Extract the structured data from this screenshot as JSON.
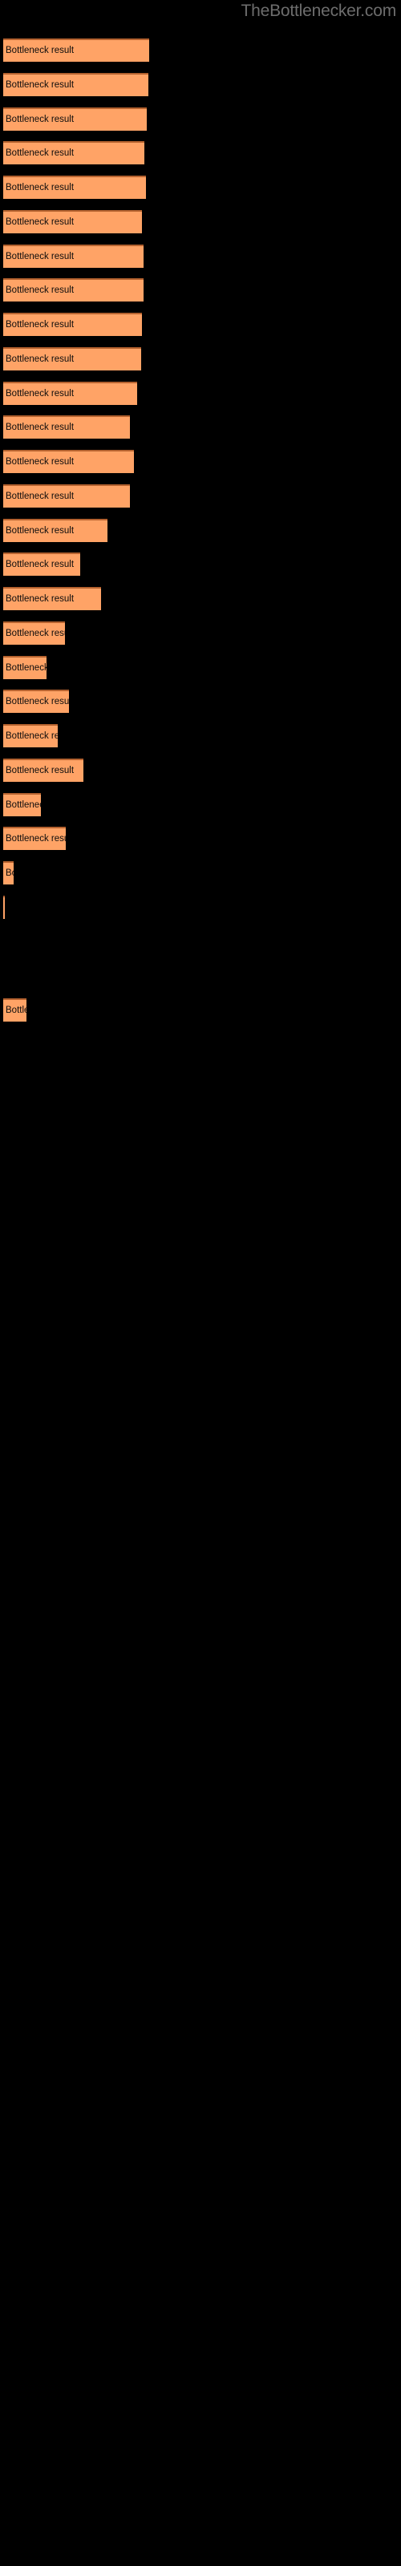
{
  "site": {
    "title": "TheBottlenecker.com",
    "title_color": "#6d6d6d"
  },
  "style": {
    "background": "#000000",
    "bar_fill": "#ffa366",
    "bar_top_border": "#b5622f",
    "label_color": "#0d0d0d"
  },
  "chart_data": {
    "type": "bar",
    "orientation": "horizontal",
    "title": "TheBottlenecker.com",
    "xlabel": "",
    "ylabel": "",
    "grid": false,
    "legend": null,
    "bar_label_text": "Bottleneck result",
    "xlim": [
      0,
      186
    ],
    "note": "Horizontal bar chart on black background; every bar is annotated with the text 'Bottleneck result' which is clipped to the bar width.",
    "categories": [
      "Bottleneck result",
      "Bottleneck result",
      "Bottleneck result",
      "Bottleneck result",
      "Bottleneck result",
      "Bottleneck result",
      "Bottleneck result",
      "Bottleneck result",
      "Bottleneck result",
      "Bottleneck result",
      "Bottleneck result",
      "Bottleneck result",
      "Bottleneck result",
      "Bottleneck result",
      "Bottleneck result",
      "Bottleneck result",
      "Bottleneck result",
      "Bottleneck result",
      "Bottleneck result",
      "Bottleneck result",
      "Bottleneck result",
      "Bottleneck result",
      "Bottleneck result",
      "Bottleneck result",
      "Bottleneck result",
      "Bottleneck result",
      "Bottleneck result",
      "Bottleneck result",
      "Bottleneck result",
      "Bottleneck result"
    ],
    "values": [
      182,
      181,
      179,
      176,
      178,
      173,
      175,
      175,
      173,
      172,
      167,
      158,
      163,
      158,
      130,
      96,
      122,
      77,
      54,
      82,
      68,
      100,
      47,
      78,
      13,
      2,
      0,
      0,
      29,
      0
    ],
    "bar_rows": [
      {
        "index": 0,
        "label": "Bottleneck result",
        "width": 182,
        "y": 48
      },
      {
        "index": 1,
        "label": "Bottleneck result",
        "width": 181,
        "y": 91
      },
      {
        "index": 2,
        "label": "Bottleneck result",
        "width": 179,
        "y": 134
      },
      {
        "index": 3,
        "label": "Bottleneck result",
        "width": 176,
        "y": 176
      },
      {
        "index": 4,
        "label": "Bottleneck result",
        "width": 178,
        "y": 219
      },
      {
        "index": 5,
        "label": "Bottleneck result",
        "width": 173,
        "y": 262
      },
      {
        "index": 6,
        "label": "Bottleneck result",
        "width": 175,
        "y": 305
      },
      {
        "index": 7,
        "label": "Bottleneck result",
        "width": 175,
        "y": 347
      },
      {
        "index": 8,
        "label": "Bottleneck result",
        "width": 173,
        "y": 390
      },
      {
        "index": 9,
        "label": "Bottleneck result",
        "width": 172,
        "y": 433
      },
      {
        "index": 10,
        "label": "Bottleneck result",
        "width": 167,
        "y": 476
      },
      {
        "index": 11,
        "label": "Bottleneck result",
        "width": 158,
        "y": 518
      },
      {
        "index": 12,
        "label": "Bottleneck result",
        "width": 163,
        "y": 561
      },
      {
        "index": 13,
        "label": "Bottleneck result",
        "width": 158,
        "y": 604
      },
      {
        "index": 14,
        "label": "Bottleneck result",
        "width": 130,
        "y": 647
      },
      {
        "index": 15,
        "label": "Bottleneck result",
        "width": 96,
        "y": 689
      },
      {
        "index": 16,
        "label": "Bottleneck result",
        "width": 122,
        "y": 732
      },
      {
        "index": 17,
        "label": "Bottleneck result",
        "width": 77,
        "y": 775
      },
      {
        "index": 18,
        "label": "Bottleneck result",
        "width": 54,
        "y": 818
      },
      {
        "index": 19,
        "label": "Bottleneck result",
        "width": 82,
        "y": 860
      },
      {
        "index": 20,
        "label": "Bottleneck result",
        "width": 68,
        "y": 903
      },
      {
        "index": 21,
        "label": "Bottleneck result",
        "width": 100,
        "y": 946
      },
      {
        "index": 22,
        "label": "Bottleneck result",
        "width": 47,
        "y": 989
      },
      {
        "index": 23,
        "label": "Bottleneck result",
        "width": 78,
        "y": 1031
      },
      {
        "index": 24,
        "label": "Bottleneck result",
        "width": 13,
        "y": 1074
      },
      {
        "index": 25,
        "label": "Bottleneck result",
        "width": 2,
        "y": 1117
      },
      {
        "index": 26,
        "label": "Bottleneck result",
        "width": 0,
        "y": 1160
      },
      {
        "index": 27,
        "label": "Bottleneck result",
        "width": 0,
        "y": 1202
      },
      {
        "index": 28,
        "label": "Bottleneck result",
        "width": 29,
        "y": 1245
      },
      {
        "index": 29,
        "label": "Bottleneck result",
        "width": 0,
        "y": 1288
      }
    ]
  }
}
